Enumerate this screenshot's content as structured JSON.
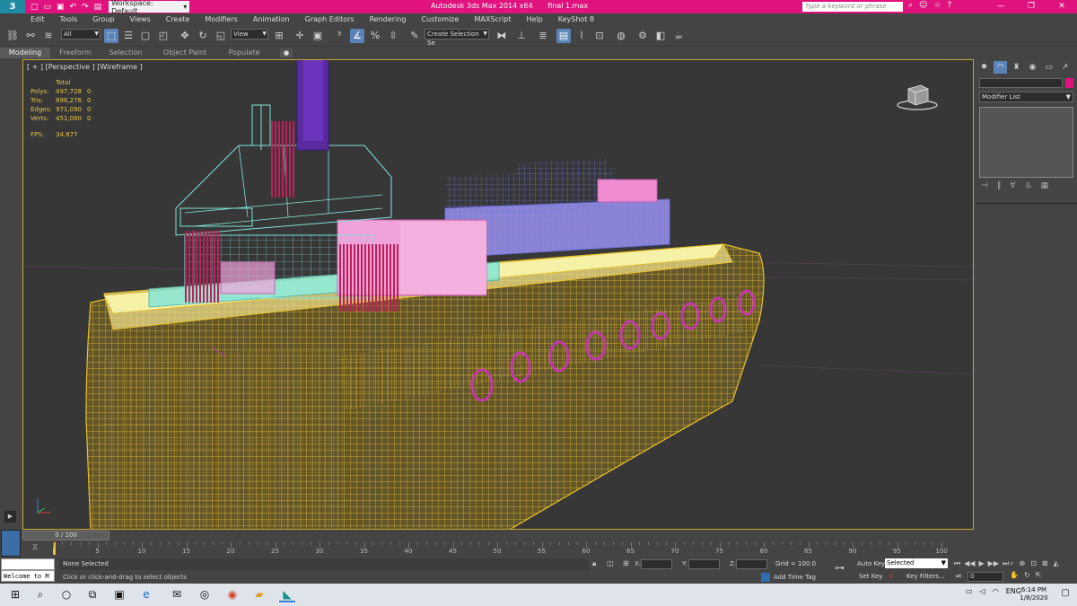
{
  "titlebar": {
    "app_logo": "3",
    "workspace": "Workspace: Default",
    "doc_title": "Autodesk 3ds Max 2014 x64",
    "file_name": "final 1.max",
    "search_placeholder": "Type a keyword or phrase",
    "accent": "#e0127e",
    "win_min": "—",
    "win_max": "❐",
    "win_close": "✕"
  },
  "menubar": {
    "items": [
      "Edit",
      "Tools",
      "Group",
      "Views",
      "Create",
      "Modifiers",
      "Animation",
      "Graph Editors",
      "Rendering",
      "Customize",
      "MAXScript",
      "Help",
      "KeyShot 8"
    ]
  },
  "toolbar": {
    "filter_dropdown": "All",
    "ref_coord_dropdown": "View",
    "selection_set": "Create Selection Se"
  },
  "ribbon": {
    "tabs": [
      "Modeling",
      "Freeform",
      "Selection",
      "Object Paint",
      "Populate"
    ],
    "pin": "●"
  },
  "viewport": {
    "label": "[ + ] [Perspective ] [Wireframe ]",
    "stats": {
      "header": "Total",
      "rows": [
        {
          "k": "Polys:",
          "v": "497,728",
          "z": "0"
        },
        {
          "k": "Tris:",
          "v": "896,276",
          "z": "0"
        },
        {
          "k": "Edges:",
          "v": "971,090",
          "z": "0"
        },
        {
          "k": "Verts:",
          "v": "451,080",
          "z": "0"
        }
      ],
      "fps_label": "FPS:",
      "fps_value": "34.877"
    },
    "border_color": "#c9a634"
  },
  "cmdpanel": {
    "modifier_list": "Modifier List"
  },
  "timeline": {
    "frame_range": "0 / 100",
    "ticks": [
      0,
      5,
      10,
      15,
      20,
      25,
      30,
      35,
      40,
      45,
      50,
      55,
      60,
      65,
      70,
      75,
      80,
      85,
      90,
      95,
      100
    ],
    "tick_labels": [
      "5",
      "10",
      "15",
      "20",
      "25",
      "30",
      "35",
      "40",
      "45",
      "50",
      "55",
      "60",
      "65",
      "70",
      "75",
      "80",
      "85",
      "90",
      "95",
      "100"
    ]
  },
  "statusbar": {
    "welcome": "Welcome to M",
    "selection_status": "None Selected",
    "prompt": "Click or click-and-drag to select objects",
    "x_label": "X:",
    "y_label": "Y:",
    "z_label": "Z:",
    "grid": "Grid = 100.0",
    "add_time_tag": "Add Time Tag",
    "auto_key": "Auto Key",
    "set_key": "Set Key",
    "selected_dropdown": "Selected",
    "key_filters": "Key Filters...",
    "frame": "0"
  },
  "taskbar": {
    "lang": "ENG",
    "time": "6:14 PM",
    "date": "1/8/2020"
  }
}
